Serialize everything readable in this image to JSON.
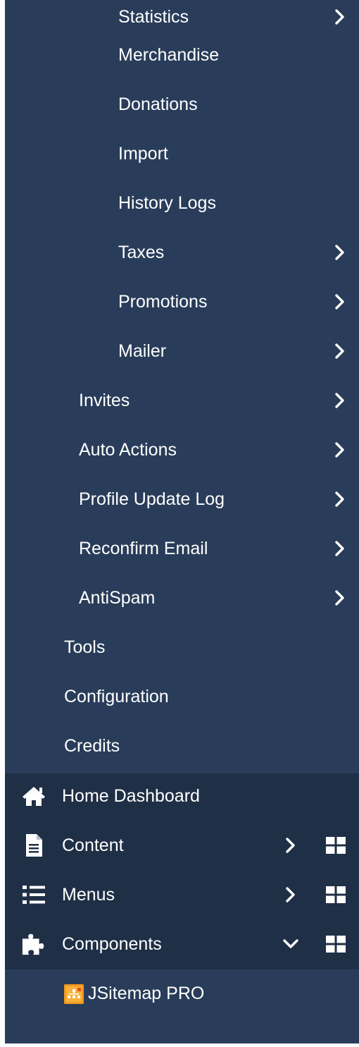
{
  "menu": {
    "nested_items": [
      {
        "label": "Statistics",
        "has_chevron": true
      },
      {
        "label": "Merchandise",
        "has_chevron": false
      },
      {
        "label": "Donations",
        "has_chevron": false
      },
      {
        "label": "Import",
        "has_chevron": false
      },
      {
        "label": "History Logs",
        "has_chevron": false
      },
      {
        "label": "Taxes",
        "has_chevron": true
      },
      {
        "label": "Promotions",
        "has_chevron": true
      },
      {
        "label": "Mailer",
        "has_chevron": true
      }
    ],
    "sub_items": [
      {
        "label": "Invites",
        "has_chevron": true
      },
      {
        "label": "Auto Actions",
        "has_chevron": true
      },
      {
        "label": "Profile Update Log",
        "has_chevron": true
      },
      {
        "label": "Reconfirm Email",
        "has_chevron": true
      },
      {
        "label": "AntiSpam",
        "has_chevron": true
      }
    ],
    "plain_items": [
      {
        "label": "Tools"
      },
      {
        "label": "Configuration"
      },
      {
        "label": "Credits"
      }
    ],
    "main_items": {
      "home": {
        "label": "Home Dashboard",
        "icon": "home-icon"
      },
      "content": {
        "label": "Content",
        "icon": "file-icon",
        "expanded": false
      },
      "menus": {
        "label": "Menus",
        "icon": "list-icon",
        "expanded": false
      },
      "components": {
        "label": "Components",
        "icon": "puzzle-icon",
        "expanded": true
      }
    },
    "component_children": [
      {
        "label": "JSitemap PRO",
        "icon": "jsitemap-icon"
      }
    ]
  },
  "colors": {
    "panel": "#293d5a",
    "panel_dark": "#1f2f46",
    "text": "#ffffff",
    "jsitemap_orange": "#f39a1e"
  }
}
